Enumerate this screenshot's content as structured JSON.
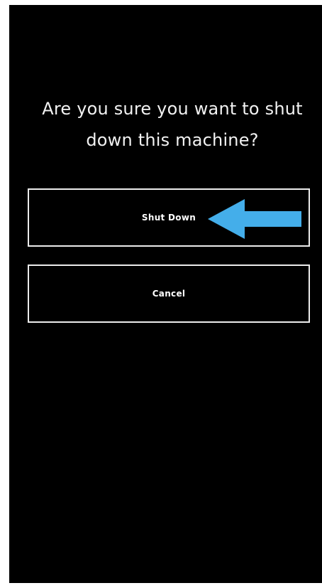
{
  "dialog": {
    "message_line1": "Are you sure you want to shut",
    "message_line2": "down this machine?",
    "shutdown_label": "Shut Down",
    "cancel_label": "Cancel"
  },
  "annotation": {
    "icon": "arrow-left-icon",
    "color": "#44AEEA"
  },
  "colors": {
    "background": "#000000",
    "text": "#FFFFFF",
    "button_border": "#ECECEC"
  }
}
